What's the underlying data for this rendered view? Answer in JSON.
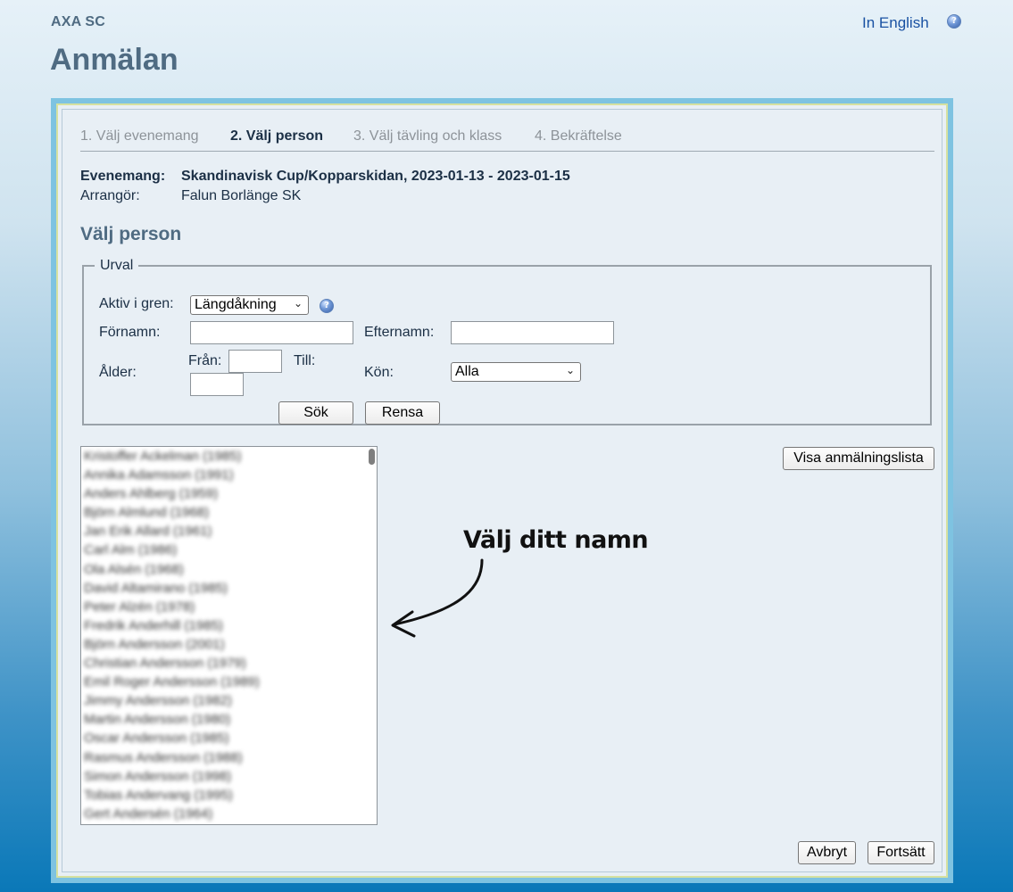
{
  "header": {
    "org": "AXA SC",
    "title": "Anmälan",
    "language_link": "In English",
    "help_icon": "help-icon"
  },
  "steps": [
    {
      "label": "1. Välj evenemang",
      "active": false
    },
    {
      "label": "2. Välj person",
      "active": true
    },
    {
      "label": "3. Välj tävling och klass",
      "active": false
    },
    {
      "label": "4. Bekräftelse",
      "active": false
    }
  ],
  "event": {
    "event_label": "Evenemang:",
    "event_value": "Skandinavisk Cup/Kopparskidan, 2023-01-13 - 2023-01-15",
    "organizer_label": "Arrangör:",
    "organizer_value": "Falun Borlänge SK"
  },
  "section_title": "Välj person",
  "filter": {
    "legend": "Urval",
    "branch_label": "Aktiv i gren:",
    "branch_value": "Längdåkning",
    "firstname_label": "Förnamn:",
    "firstname_value": "",
    "lastname_label": "Efternamn:",
    "lastname_value": "",
    "age_label": "Ålder:",
    "from_label": "Från:",
    "from_value": "",
    "to_label": "Till:",
    "to_value": "",
    "gender_label": "Kön:",
    "gender_value": "Alla",
    "search_button": "Sök",
    "clear_button": "Rensa"
  },
  "person_list": [
    "Kristoffer Ackelman (1985)",
    "Annika Adamsson (1991)",
    "Anders Ahlberg (1959)",
    "Björn Almlund (1968)",
    "Jan Erik Allard (1961)",
    "Carl Alm (1986)",
    "Ola Alsén (1968)",
    "David Altamirano (1985)",
    "Peter Alzén (1978)",
    "Fredrik Anderhill (1985)",
    "Björn Andersson (2001)",
    "Christian Andersson (1979)",
    "Emil Roger Andersson (1989)",
    "Jimmy Andersson (1982)",
    "Martin Andersson (1980)",
    "Oscar Andersson (1985)",
    "Rasmus Andersson (1988)",
    "Simon Andersson (1998)",
    "Tobias Andervang (1995)",
    "Gert Andersén (1964)"
  ],
  "show_list_button": "Visa anmälningslista",
  "annotation": "Välj ditt namn",
  "footer": {
    "cancel_button": "Avbryt",
    "continue_button": "Fortsätt"
  }
}
